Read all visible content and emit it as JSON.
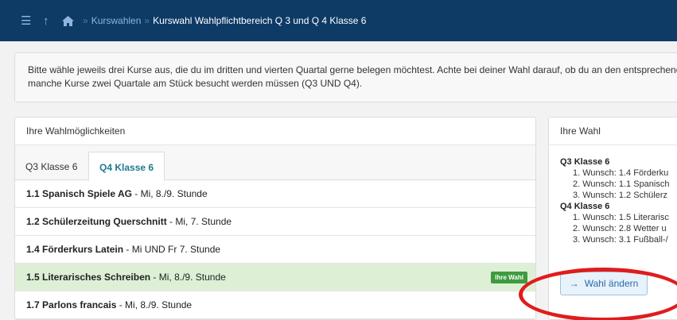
{
  "breadcrumb": {
    "parent": "Kurswahlen",
    "current": "Kurswahl Wahlpflichtbereich Q 3 und Q 4 Klasse 6"
  },
  "info": {
    "line1": "Bitte wähle jeweils drei Kurse aus, die du im dritten und vierten Quartal gerne belegen möchtest. Achte bei deiner Wahl darauf, ob du an den entsprechende",
    "line2": "manche Kurse zwei Quartale am Stück besucht werden müssen (Q3 UND Q4)."
  },
  "options_panel": {
    "heading": "Ihre Wahlmöglichkeiten",
    "tabs": [
      {
        "label": "Q3 Klasse 6",
        "active": false
      },
      {
        "label": "Q4 Klasse 6",
        "active": true
      }
    ],
    "courses": [
      {
        "title": "1.1 Spanisch Spiele AG",
        "time": " - Mi, 8./9. Stunde",
        "selected": false
      },
      {
        "title": "1.2 Schülerzeitung Querschnitt",
        "time": " - Mi, 7. Stunde",
        "selected": false
      },
      {
        "title": "1.4 Förderkurs Latein",
        "time": " - Mi UND Fr 7. Stunde",
        "selected": false
      },
      {
        "title": "1.5 Literarisches Schreiben",
        "time": " - Mi, 8./9. Stunde",
        "selected": true,
        "badge": "Ihre Wahl"
      },
      {
        "title": "1.7 Parlons francais",
        "time": " - Mi, 8./9. Stunde",
        "selected": false
      }
    ]
  },
  "choice_panel": {
    "heading": "Ihre Wahl",
    "groups": [
      {
        "title": "Q3 Klasse 6",
        "wishes": [
          "1. Wunsch: 1.4 Förderku",
          "2. Wunsch: 1.1 Spanisch",
          "3. Wunsch: 1.2 Schülerz"
        ]
      },
      {
        "title": "Q4 Klasse 6",
        "wishes": [
          "1. Wunsch: 1.5 Literarisc",
          "2. Wunsch: 2.8 Wetter u",
          "3. Wunsch: 3.1 Fußball-/"
        ]
      }
    ],
    "change_label": "Wahl ändern"
  },
  "colors": {
    "topbar": "#0e3a66",
    "selected_row": "#ddf0d6",
    "badge": "#3f9b3f",
    "active_tab": "#1f7a8c",
    "annotation": "#e01c1c"
  },
  "icons": {
    "menu": "menu-icon",
    "up": "up-arrow-icon",
    "home": "home-icon",
    "arrow": "arrow-right-icon"
  }
}
